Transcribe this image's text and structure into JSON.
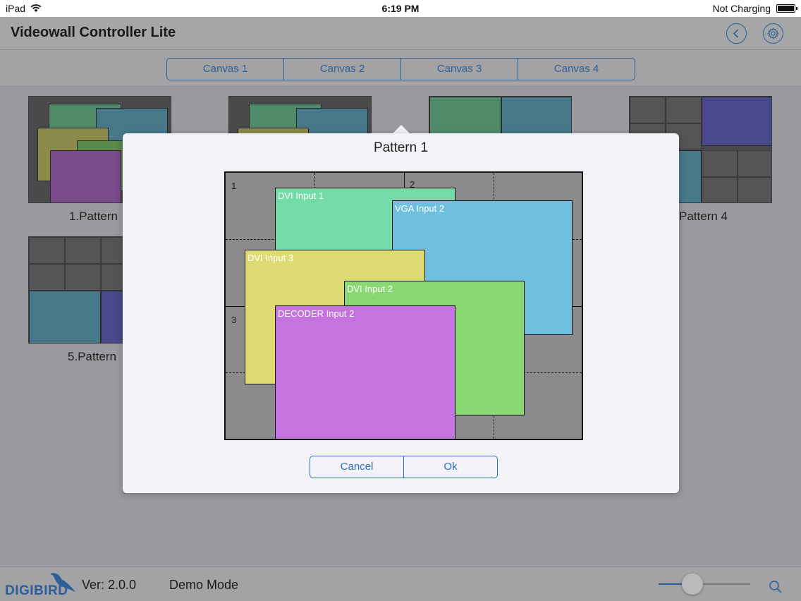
{
  "status_bar": {
    "device": "iPad",
    "time": "6:19 PM",
    "charging": "Not Charging",
    "wifi_icon": "wifi-icon",
    "battery_icon": "battery-icon"
  },
  "header": {
    "title": "Videowall Controller Lite",
    "back_icon": "chevron-left-icon",
    "settings_icon": "gear-icon"
  },
  "canvas_tabs": [
    "Canvas 1",
    "Canvas 2",
    "Canvas 3",
    "Canvas 4"
  ],
  "patterns": {
    "labels": [
      "1.Pattern",
      "Pattern 4",
      "5.Pattern"
    ]
  },
  "modal": {
    "title": "Pattern 1",
    "screen_numbers": [
      "1",
      "2",
      "3"
    ],
    "windows": [
      {
        "label": "DVI Input 1",
        "color": "#73dba8"
      },
      {
        "label": "VGA Input 2",
        "color": "#6ec0de"
      },
      {
        "label": "DVI Input 3",
        "color": "#dedb73"
      },
      {
        "label": "DVI Input 2",
        "color": "#8ad873"
      },
      {
        "label": "DECODER Input 2",
        "color": "#c574df"
      }
    ],
    "buttons": {
      "cancel": "Cancel",
      "ok": "Ok"
    }
  },
  "footer": {
    "logo_text": "DIGIBIRD",
    "logo_icon": "bird-icon",
    "version": "Ver: 2.0.0",
    "mode": "Demo Mode",
    "zoom_icon": "search-icon",
    "zoom_level": 0.37
  },
  "colors": {
    "accent": "#2c5e98",
    "modal_bg": "#f2f2f7"
  }
}
